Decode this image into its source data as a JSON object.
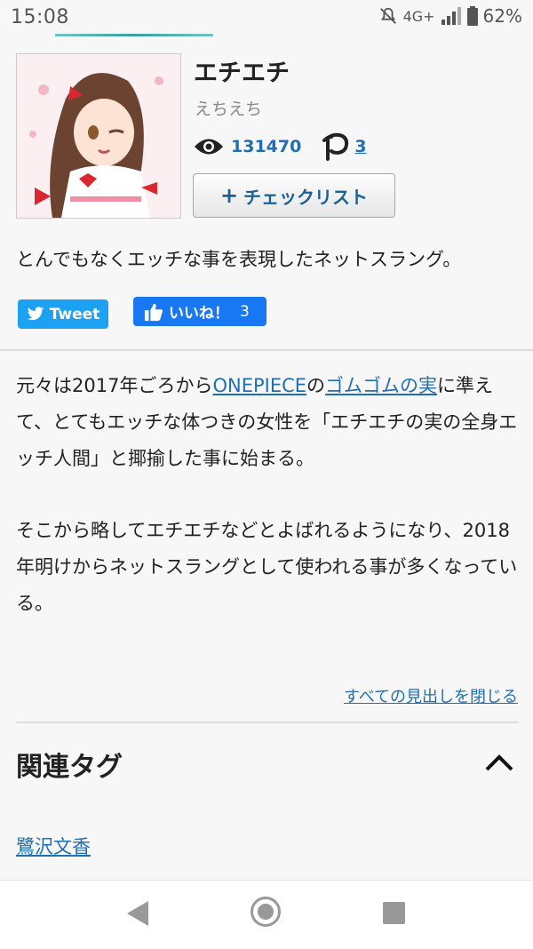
{
  "status_bar": {
    "time": "15:08",
    "network": "4G+",
    "battery": "62%",
    "icons": [
      "notifications-off-icon",
      "signal-icon",
      "battery-icon"
    ]
  },
  "article": {
    "title": "エチエチ",
    "reading": "えちえち",
    "views": "131470",
    "pixiv_count": "3",
    "checklist_label": "チェックリスト",
    "summary": "とんでもなくエッチな事を表現したネットスラング。",
    "thumbnail_alt": "illustration-thumbnail"
  },
  "social": {
    "tweet_label": "Tweet",
    "like_label": "いいね！",
    "like_count": "3"
  },
  "body": {
    "p1_a": "元々は2017年ごろから",
    "p1_link1": "ONEPIECE",
    "p1_b": "の",
    "p1_link2": "ゴムゴムの実",
    "p1_c": "に準えて、とてもエッチな体つきの女性を「エチエチの実の全身エッチ人間」と揶揄した事に始まる。",
    "p2": "そこから略してエチエチなどとよばれるようになり、2018年明けからネットスラングとして使われる事が多くなっている。"
  },
  "toc_close_label": "すべての見出しを閉じる",
  "related": {
    "heading": "関連タグ",
    "tags": [
      "鷺沢文香"
    ]
  },
  "colors": {
    "link": "#1f6fb2",
    "twitter": "#1da1f2",
    "facebook": "#1877f2"
  }
}
